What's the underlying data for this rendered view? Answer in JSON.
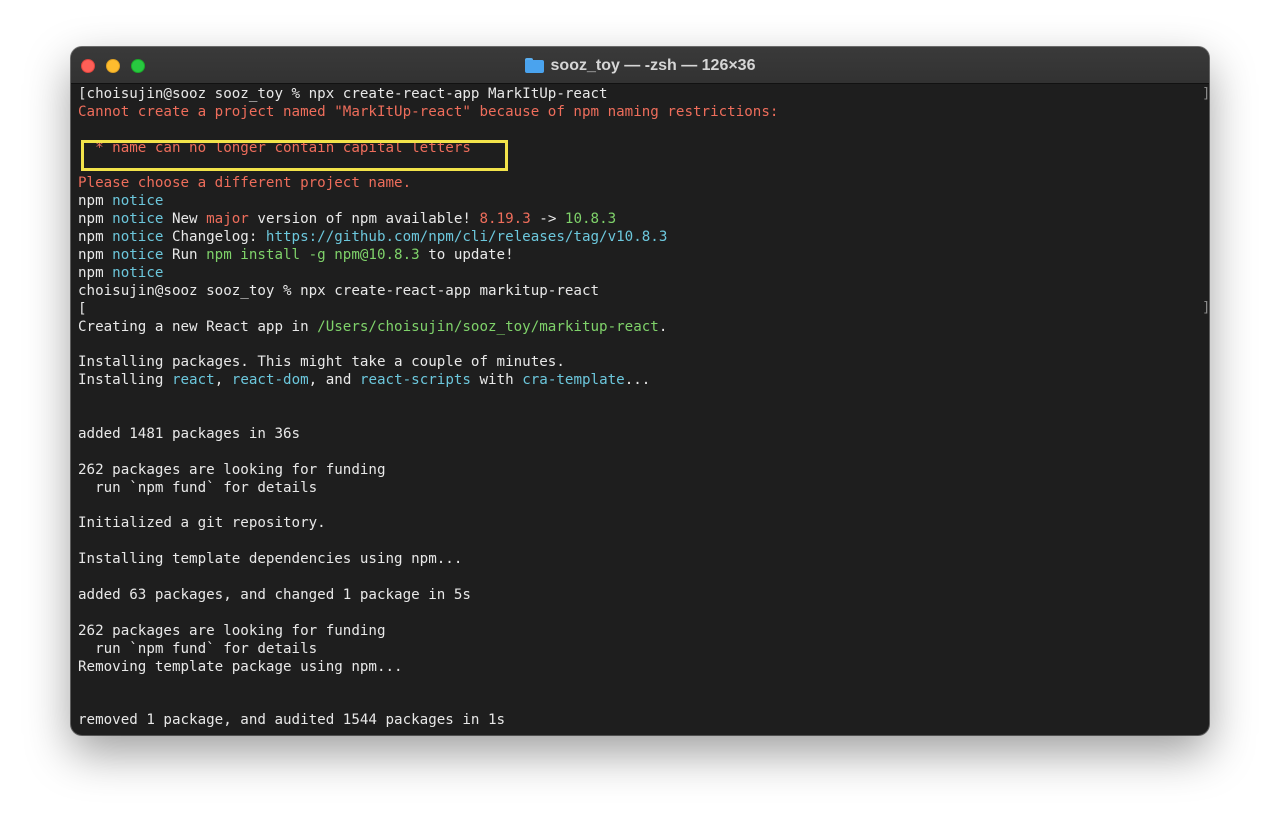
{
  "window": {
    "title": "sooz_toy — -zsh — 126×36",
    "folder_icon": "folder-icon"
  },
  "colors": {
    "error": "#ee6d5b",
    "notice": "#6cc7dc",
    "version_new": "#7fd26a",
    "highlight": "#f2e34a",
    "background": "#1e1e1e"
  },
  "terminal": {
    "lines": [
      [
        {
          "t": "[choisujin@sooz sooz_toy % npx create-react-app MarkItUp-react",
          "c": "white"
        }
      ],
      [
        {
          "t": "Cannot create a project named \"MarkItUp-react\" because of npm naming restrictions:",
          "c": "red"
        }
      ],
      [],
      [
        {
          "t": "  * name can no longer contain capital letters",
          "c": "red"
        }
      ],
      [],
      [
        {
          "t": "Please choose a different project name.",
          "c": "red"
        }
      ],
      [
        {
          "t": "npm ",
          "c": "white"
        },
        {
          "t": "notice",
          "c": "cyan"
        }
      ],
      [
        {
          "t": "npm ",
          "c": "white"
        },
        {
          "t": "notice",
          "c": "cyan"
        },
        {
          "t": " New ",
          "c": "white"
        },
        {
          "t": "major",
          "c": "red"
        },
        {
          "t": " version of npm available! ",
          "c": "white"
        },
        {
          "t": "8.19.3",
          "c": "red"
        },
        {
          "t": " -> ",
          "c": "white"
        },
        {
          "t": "10.8.3",
          "c": "green"
        }
      ],
      [
        {
          "t": "npm ",
          "c": "white"
        },
        {
          "t": "notice",
          "c": "cyan"
        },
        {
          "t": " Changelog: ",
          "c": "white"
        },
        {
          "t": "https://github.com/npm/cli/releases/tag/v10.8.3",
          "c": "cyan"
        }
      ],
      [
        {
          "t": "npm ",
          "c": "white"
        },
        {
          "t": "notice",
          "c": "cyan"
        },
        {
          "t": " Run ",
          "c": "white"
        },
        {
          "t": "npm install -g npm@10.8.3",
          "c": "green"
        },
        {
          "t": " to update!",
          "c": "white"
        }
      ],
      [
        {
          "t": "npm ",
          "c": "white"
        },
        {
          "t": "notice",
          "c": "cyan"
        }
      ],
      [
        {
          "t": "choisujin@sooz sooz_toy % npx create-react-app markitup-react",
          "c": "white"
        }
      ],
      [
        {
          "t": "[",
          "c": "white"
        }
      ],
      [
        {
          "t": "Creating a new React app in ",
          "c": "white"
        },
        {
          "t": "/Users/choisujin/sooz_toy/markitup-react",
          "c": "green"
        },
        {
          "t": ".",
          "c": "white"
        }
      ],
      [],
      [
        {
          "t": "Installing packages. This might take a couple of minutes.",
          "c": "white"
        }
      ],
      [
        {
          "t": "Installing ",
          "c": "white"
        },
        {
          "t": "react",
          "c": "cyan"
        },
        {
          "t": ", ",
          "c": "white"
        },
        {
          "t": "react-dom",
          "c": "cyan"
        },
        {
          "t": ", and ",
          "c": "white"
        },
        {
          "t": "react-scripts",
          "c": "cyan"
        },
        {
          "t": " with ",
          "c": "white"
        },
        {
          "t": "cra-template",
          "c": "cyan"
        },
        {
          "t": "...",
          "c": "white"
        }
      ],
      [],
      [],
      [
        {
          "t": "added 1481 packages in 36s",
          "c": "white"
        }
      ],
      [],
      [
        {
          "t": "262 packages are looking for funding",
          "c": "white"
        }
      ],
      [
        {
          "t": "  run `npm fund` for details",
          "c": "white"
        }
      ],
      [],
      [
        {
          "t": "Initialized a git repository.",
          "c": "white"
        }
      ],
      [],
      [
        {
          "t": "Installing template dependencies using npm...",
          "c": "white"
        }
      ],
      [],
      [
        {
          "t": "added 63 packages, and changed 1 package in 5s",
          "c": "white"
        }
      ],
      [],
      [
        {
          "t": "262 packages are looking for funding",
          "c": "white"
        }
      ],
      [
        {
          "t": "  run `npm fund` for details",
          "c": "white"
        }
      ],
      [
        {
          "t": "Removing template package using npm...",
          "c": "white"
        }
      ],
      [],
      [],
      [
        {
          "t": "removed 1 package, and audited 1544 packages in 1s",
          "c": "white"
        }
      ]
    ],
    "right_brackets": [
      "]",
      "]"
    ]
  }
}
